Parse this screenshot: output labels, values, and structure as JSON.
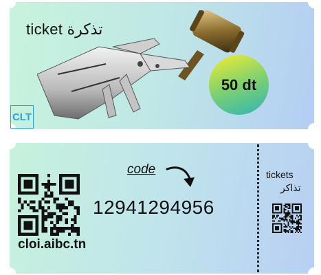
{
  "top": {
    "title": "ticket تذكرة",
    "price": "50 dt",
    "brand": "CLT"
  },
  "bottom": {
    "code_label": "code",
    "number": "12941294956",
    "site": "cloi.aibc.tn",
    "stub_line1": "tickets",
    "stub_line2": "تذاكر"
  },
  "colors": {
    "gradient_start": "#c8f3dc",
    "gradient_end": "#b4cdf4",
    "accent": "#2aa3e8",
    "price_yellow": "#f6ec2f",
    "price_teal": "#2fb5b6"
  },
  "icons": [
    "robot-hand-image",
    "gavel-image",
    "arrow-icon",
    "qr-code-icon",
    "small-qr-code-icon"
  ]
}
